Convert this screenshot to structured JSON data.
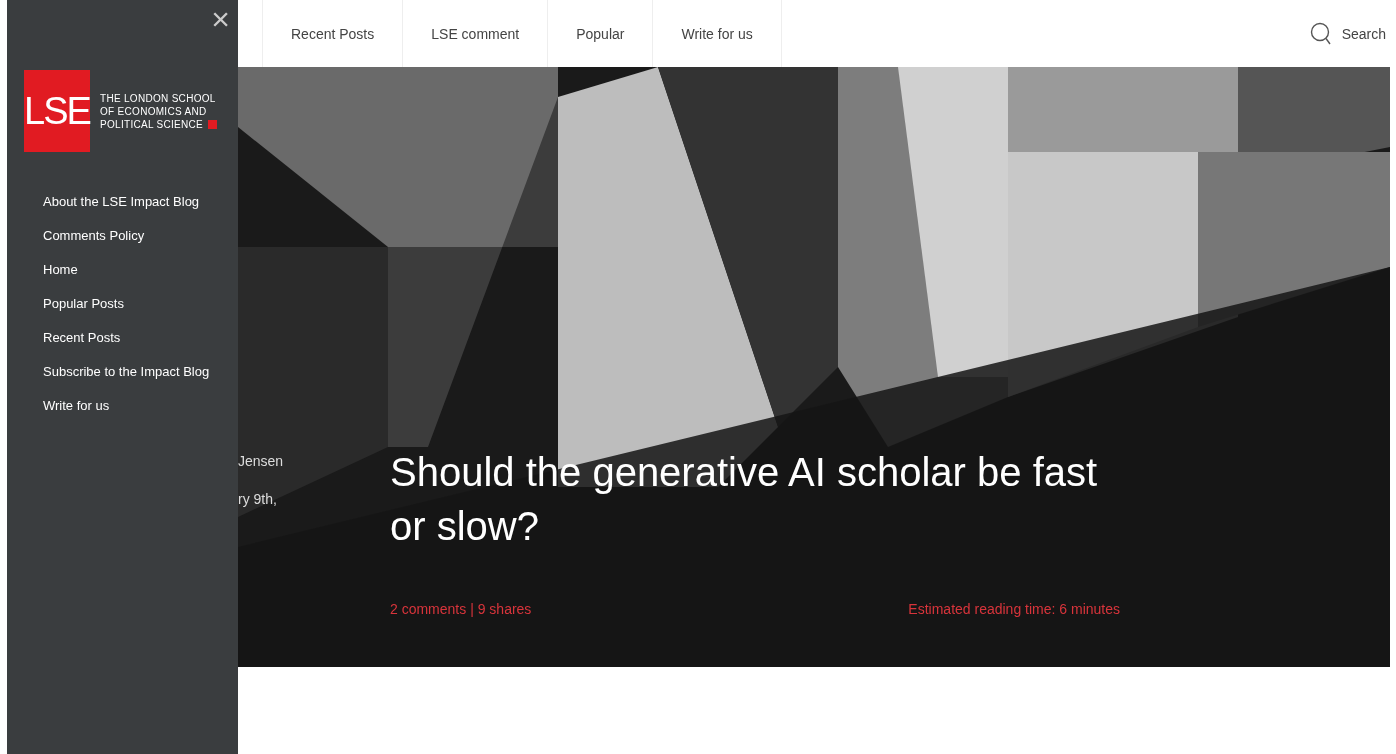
{
  "sidebar": {
    "close": "×",
    "logo": {
      "mark": "LSE",
      "lines": [
        "THE LONDON SCHOOL",
        "OF ECONOMICS AND",
        "POLITICAL SCIENCE"
      ]
    },
    "items": [
      {
        "label": "About the LSE Impact Blog"
      },
      {
        "label": "Comments Policy"
      },
      {
        "label": "Home"
      },
      {
        "label": "Popular Posts"
      },
      {
        "label": "Recent Posts"
      },
      {
        "label": "Subscribe to the Impact Blog"
      },
      {
        "label": "Write for us"
      }
    ]
  },
  "nav": {
    "items": [
      {
        "label": "Recent Posts"
      },
      {
        "label": "LSE comment"
      },
      {
        "label": "Popular"
      },
      {
        "label": "Write for us"
      }
    ],
    "search": "Search"
  },
  "hero": {
    "author": "Jensen",
    "date": "ry 9th,",
    "title": "Should the generative AI scholar be fast or slow?",
    "stats": "2 comments | 9 shares",
    "reading_time": "Estimated reading time: 6 minutes"
  }
}
